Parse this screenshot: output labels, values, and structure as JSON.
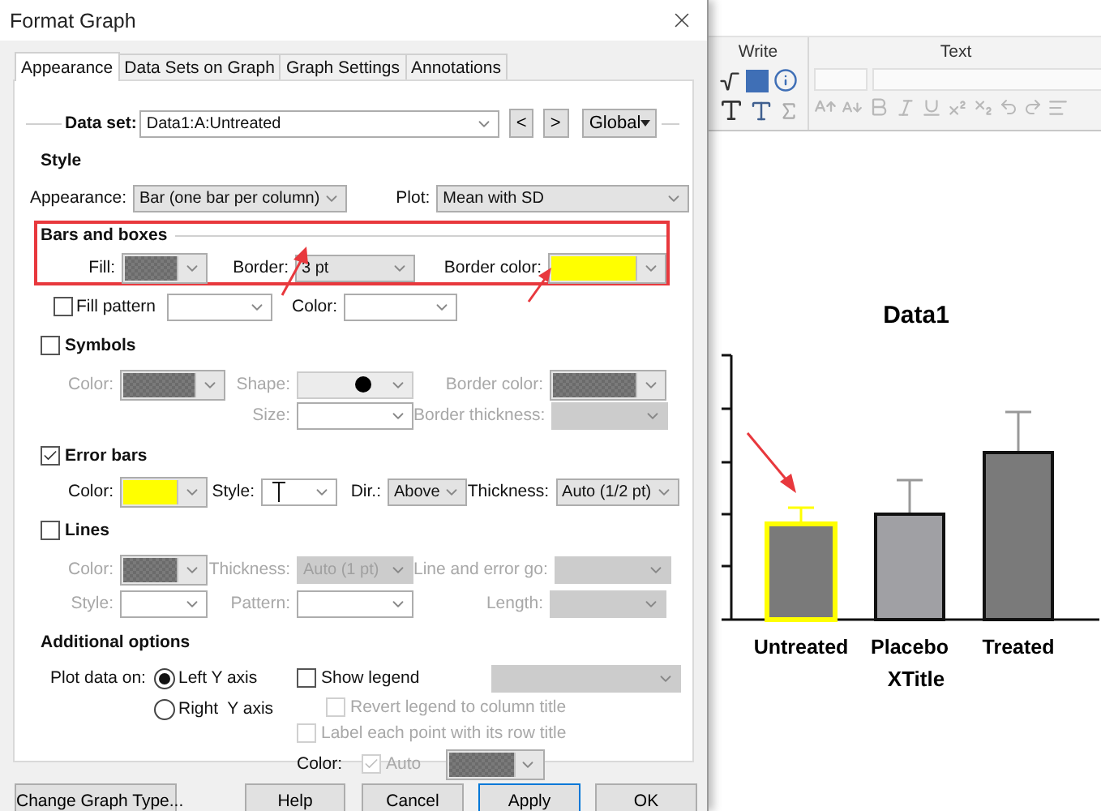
{
  "window": {
    "title": "Format Graph"
  },
  "tabs": [
    {
      "label": "Appearance",
      "selected": true
    },
    {
      "label": "Data Sets on Graph",
      "selected": false
    },
    {
      "label": "Graph Settings",
      "selected": false
    },
    {
      "label": "Annotations",
      "selected": false
    }
  ],
  "data_set": {
    "label": "Data set:",
    "value": "Data1:A:Untreated",
    "prev": "<",
    "next": ">",
    "scope": "Global"
  },
  "style": {
    "heading": "Style",
    "appearance": {
      "label": "Appearance:",
      "value": "Bar (one bar per column)"
    },
    "plot": {
      "label": "Plot:",
      "value": "Mean with SD"
    }
  },
  "bars_and_boxes": {
    "heading": "Bars and boxes",
    "highlighted": true,
    "fill": {
      "label": "Fill:",
      "color": "#7a7a7a",
      "checkered": true
    },
    "border": {
      "label": "Border:",
      "value": "3 pt"
    },
    "border_color": {
      "label": "Border color:",
      "color": "#ffff00",
      "checkered": false
    },
    "fill_pattern": {
      "label": "Fill pattern",
      "checked": false
    },
    "pattern_color": {
      "label": "Color:"
    }
  },
  "symbols": {
    "heading": "Symbols",
    "checked": false,
    "color_label": "Color:",
    "shape_label": "Shape:",
    "border_color_label": "Border color:",
    "size_label": "Size:",
    "border_thickness_label": "Border thickness:"
  },
  "error_bars": {
    "heading": "Error bars",
    "checked": true,
    "color": {
      "label": "Color:",
      "color": "#ffff00"
    },
    "style_label": "Style:",
    "direction": {
      "label": "Dir.:",
      "value": "Above"
    },
    "thickness": {
      "label": "Thickness:",
      "value": "Auto (1/2 pt)"
    }
  },
  "lines": {
    "heading": "Lines",
    "checked": false,
    "color_label": "Color:",
    "thickness": {
      "label": "Thickness:",
      "value": "Auto (1 pt)"
    },
    "line_and_error_label": "Line and error go:",
    "style_label": "Style:",
    "pattern_label": "Pattern:",
    "length_label": "Length:"
  },
  "additional": {
    "heading": "Additional options",
    "plot_on_label": "Plot data on:",
    "axes": [
      {
        "label": "Left Y axis",
        "selected": true
      },
      {
        "label": "Right  Y axis",
        "selected": false
      }
    ],
    "show_legend": {
      "label": "Show legend",
      "checked": false,
      "disabled": false
    },
    "revert_legend": {
      "label": "Revert legend to column title",
      "checked": false,
      "disabled": true
    },
    "label_points": {
      "label": "Label each point with its row title",
      "checked": false,
      "disabled": true
    },
    "color_label": "Color:",
    "auto": {
      "label": "Auto",
      "checked": true,
      "disabled": true
    }
  },
  "buttons": [
    {
      "label": "Change Graph Type...",
      "default": false
    },
    {
      "label": "Help",
      "default": false
    },
    {
      "label": "Cancel",
      "default": false
    },
    {
      "label": "Apply",
      "default": true
    },
    {
      "label": "OK",
      "default": false
    }
  ],
  "ribbon": {
    "groups": [
      {
        "title": "Write"
      },
      {
        "title": "Text"
      }
    ]
  },
  "graph": {
    "title": "Data1",
    "categories": [
      "Untreated",
      "Placebo",
      "Treated"
    ],
    "xlabel": "XTitle"
  }
}
